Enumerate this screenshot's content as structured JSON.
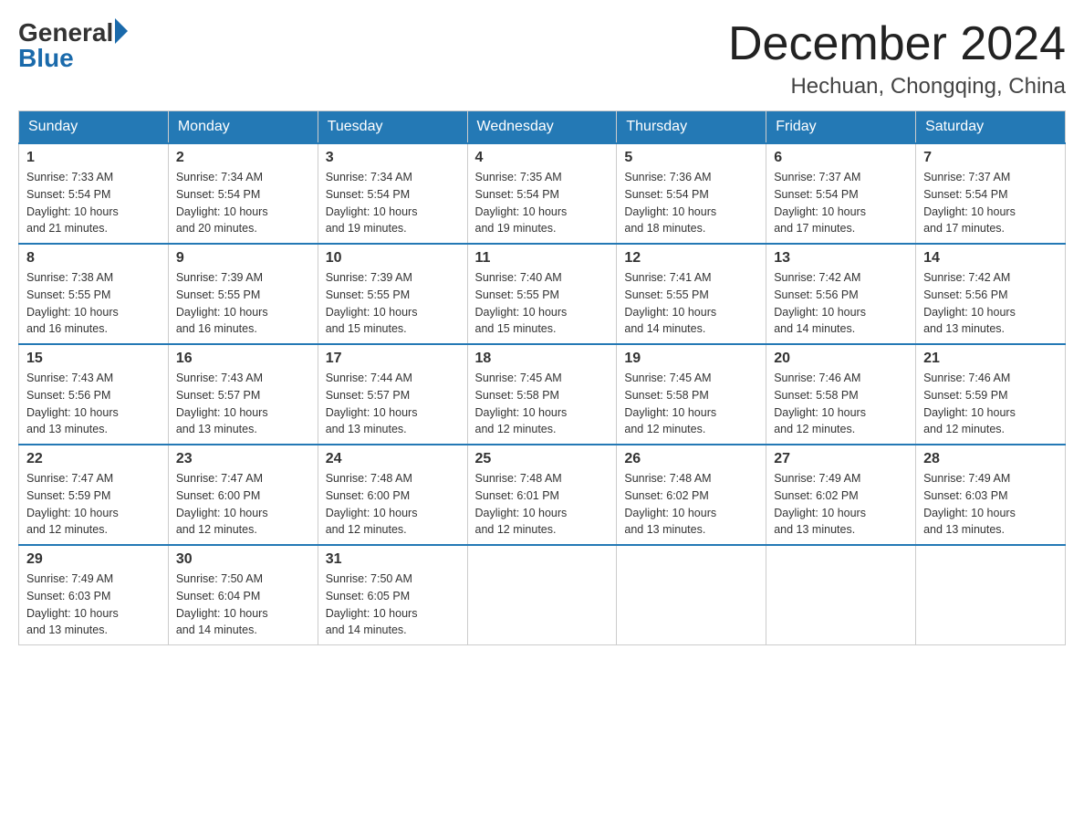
{
  "header": {
    "logo_general": "General",
    "logo_blue": "Blue",
    "month_title": "December 2024",
    "location": "Hechuan, Chongqing, China"
  },
  "days_of_week": [
    "Sunday",
    "Monday",
    "Tuesday",
    "Wednesday",
    "Thursday",
    "Friday",
    "Saturday"
  ],
  "weeks": [
    [
      {
        "day": "1",
        "sunrise": "7:33 AM",
        "sunset": "5:54 PM",
        "daylight": "10 hours and 21 minutes."
      },
      {
        "day": "2",
        "sunrise": "7:34 AM",
        "sunset": "5:54 PM",
        "daylight": "10 hours and 20 minutes."
      },
      {
        "day": "3",
        "sunrise": "7:34 AM",
        "sunset": "5:54 PM",
        "daylight": "10 hours and 19 minutes."
      },
      {
        "day": "4",
        "sunrise": "7:35 AM",
        "sunset": "5:54 PM",
        "daylight": "10 hours and 19 minutes."
      },
      {
        "day": "5",
        "sunrise": "7:36 AM",
        "sunset": "5:54 PM",
        "daylight": "10 hours and 18 minutes."
      },
      {
        "day": "6",
        "sunrise": "7:37 AM",
        "sunset": "5:54 PM",
        "daylight": "10 hours and 17 minutes."
      },
      {
        "day": "7",
        "sunrise": "7:37 AM",
        "sunset": "5:54 PM",
        "daylight": "10 hours and 17 minutes."
      }
    ],
    [
      {
        "day": "8",
        "sunrise": "7:38 AM",
        "sunset": "5:55 PM",
        "daylight": "10 hours and 16 minutes."
      },
      {
        "day": "9",
        "sunrise": "7:39 AM",
        "sunset": "5:55 PM",
        "daylight": "10 hours and 16 minutes."
      },
      {
        "day": "10",
        "sunrise": "7:39 AM",
        "sunset": "5:55 PM",
        "daylight": "10 hours and 15 minutes."
      },
      {
        "day": "11",
        "sunrise": "7:40 AM",
        "sunset": "5:55 PM",
        "daylight": "10 hours and 15 minutes."
      },
      {
        "day": "12",
        "sunrise": "7:41 AM",
        "sunset": "5:55 PM",
        "daylight": "10 hours and 14 minutes."
      },
      {
        "day": "13",
        "sunrise": "7:42 AM",
        "sunset": "5:56 PM",
        "daylight": "10 hours and 14 minutes."
      },
      {
        "day": "14",
        "sunrise": "7:42 AM",
        "sunset": "5:56 PM",
        "daylight": "10 hours and 13 minutes."
      }
    ],
    [
      {
        "day": "15",
        "sunrise": "7:43 AM",
        "sunset": "5:56 PM",
        "daylight": "10 hours and 13 minutes."
      },
      {
        "day": "16",
        "sunrise": "7:43 AM",
        "sunset": "5:57 PM",
        "daylight": "10 hours and 13 minutes."
      },
      {
        "day": "17",
        "sunrise": "7:44 AM",
        "sunset": "5:57 PM",
        "daylight": "10 hours and 13 minutes."
      },
      {
        "day": "18",
        "sunrise": "7:45 AM",
        "sunset": "5:58 PM",
        "daylight": "10 hours and 12 minutes."
      },
      {
        "day": "19",
        "sunrise": "7:45 AM",
        "sunset": "5:58 PM",
        "daylight": "10 hours and 12 minutes."
      },
      {
        "day": "20",
        "sunrise": "7:46 AM",
        "sunset": "5:58 PM",
        "daylight": "10 hours and 12 minutes."
      },
      {
        "day": "21",
        "sunrise": "7:46 AM",
        "sunset": "5:59 PM",
        "daylight": "10 hours and 12 minutes."
      }
    ],
    [
      {
        "day": "22",
        "sunrise": "7:47 AM",
        "sunset": "5:59 PM",
        "daylight": "10 hours and 12 minutes."
      },
      {
        "day": "23",
        "sunrise": "7:47 AM",
        "sunset": "6:00 PM",
        "daylight": "10 hours and 12 minutes."
      },
      {
        "day": "24",
        "sunrise": "7:48 AM",
        "sunset": "6:00 PM",
        "daylight": "10 hours and 12 minutes."
      },
      {
        "day": "25",
        "sunrise": "7:48 AM",
        "sunset": "6:01 PM",
        "daylight": "10 hours and 12 minutes."
      },
      {
        "day": "26",
        "sunrise": "7:48 AM",
        "sunset": "6:02 PM",
        "daylight": "10 hours and 13 minutes."
      },
      {
        "day": "27",
        "sunrise": "7:49 AM",
        "sunset": "6:02 PM",
        "daylight": "10 hours and 13 minutes."
      },
      {
        "day": "28",
        "sunrise": "7:49 AM",
        "sunset": "6:03 PM",
        "daylight": "10 hours and 13 minutes."
      }
    ],
    [
      {
        "day": "29",
        "sunrise": "7:49 AM",
        "sunset": "6:03 PM",
        "daylight": "10 hours and 13 minutes."
      },
      {
        "day": "30",
        "sunrise": "7:50 AM",
        "sunset": "6:04 PM",
        "daylight": "10 hours and 14 minutes."
      },
      {
        "day": "31",
        "sunrise": "7:50 AM",
        "sunset": "6:05 PM",
        "daylight": "10 hours and 14 minutes."
      },
      null,
      null,
      null,
      null
    ]
  ],
  "labels": {
    "sunrise": "Sunrise:",
    "sunset": "Sunset:",
    "daylight": "Daylight:"
  }
}
